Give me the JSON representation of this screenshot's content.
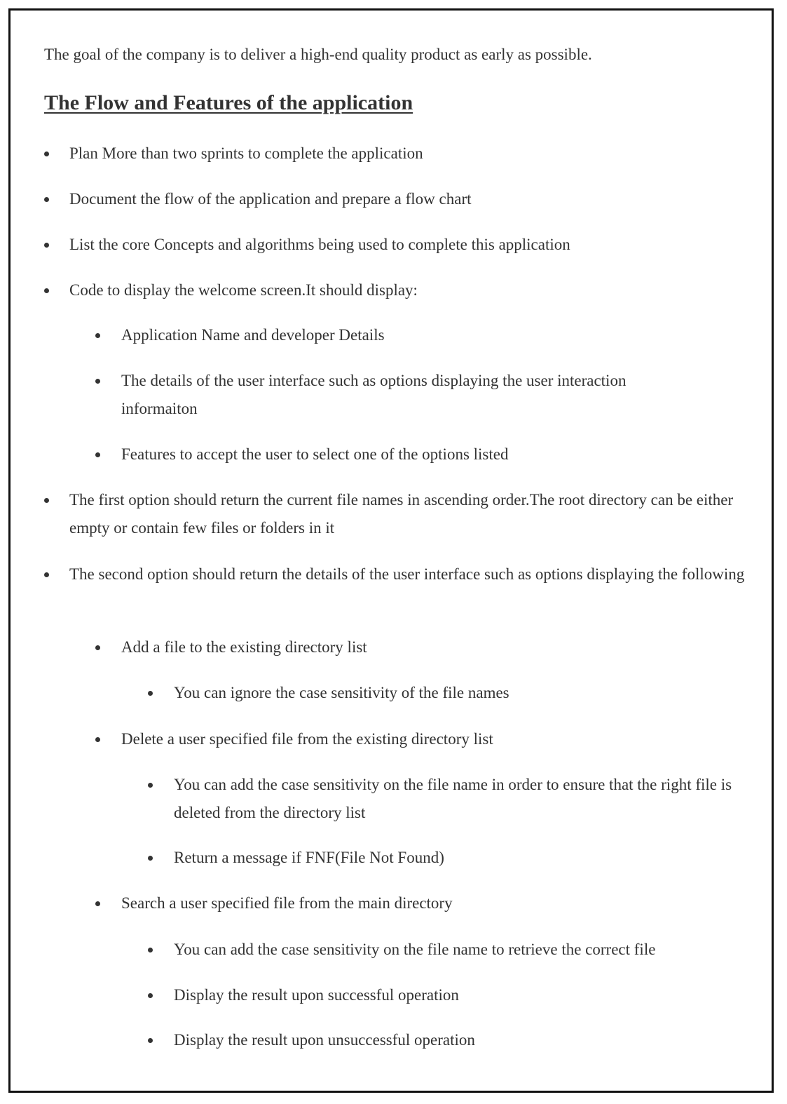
{
  "document": {
    "intro": "The goal of the company is to deliver a high-end quality product as early as possible.",
    "heading": "The Flow and Features of the application",
    "items": [
      {
        "level": 1,
        "text": "Plan More than two sprints to complete the application"
      },
      {
        "level": 1,
        "text": "Document the flow of the application and prepare a flow chart"
      },
      {
        "level": 1,
        "text": "List the core Concepts and algorithms being used to complete this application"
      },
      {
        "level": 1,
        "text": "Code to display the welcome screen.It should display:"
      },
      {
        "level": 2,
        "text": "Application Name and developer Details"
      },
      {
        "level": 2,
        "text": "The details of the user interface such as options displaying the user interaction informaiton"
      },
      {
        "level": 2,
        "text": "Features to accept the user to select one of the options listed"
      },
      {
        "level": 1,
        "text": "The first option should return the current file names in ascending order.The root directory can be either empty or contain few files or folders in it"
      },
      {
        "level": 1,
        "text": "The second option should return the details of the user interface such as options displaying the following"
      },
      {
        "level": 2,
        "text": "Add a file to the existing directory list"
      },
      {
        "level": 3,
        "text": "You can ignore the case sensitivity of the file names"
      },
      {
        "level": 2,
        "text": "Delete a user specified file from the existing directory list"
      },
      {
        "level": 3,
        "text": "You can add the case sensitivity on the file name in order to ensure that the right file is deleted from the directory list"
      },
      {
        "level": 3,
        "text": "Return a message if FNF(File Not Found)"
      },
      {
        "level": 2,
        "text": "Search a user specified file from the main directory"
      },
      {
        "level": 3,
        "text": "You can add the case sensitivity on the file name to retrieve the correct file"
      },
      {
        "level": 3,
        "text": "Display the result upon successful operation"
      },
      {
        "level": 3,
        "text": "Display the result upon unsuccessful operation"
      }
    ]
  }
}
